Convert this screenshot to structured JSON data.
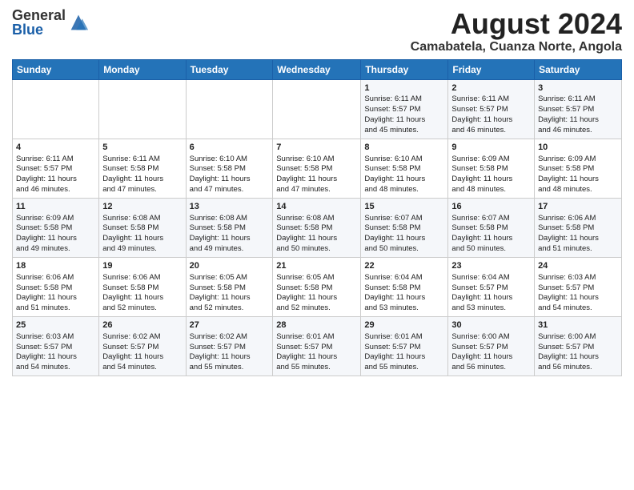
{
  "header": {
    "logo_general": "General",
    "logo_blue": "Blue",
    "month_title": "August 2024",
    "location": "Camabatela, Cuanza Norte, Angola"
  },
  "days_of_week": [
    "Sunday",
    "Monday",
    "Tuesday",
    "Wednesday",
    "Thursday",
    "Friday",
    "Saturday"
  ],
  "weeks": [
    [
      {
        "day": "",
        "info": ""
      },
      {
        "day": "",
        "info": ""
      },
      {
        "day": "",
        "info": ""
      },
      {
        "day": "",
        "info": ""
      },
      {
        "day": "1",
        "info": "Sunrise: 6:11 AM\nSunset: 5:57 PM\nDaylight: 11 hours\nand 45 minutes."
      },
      {
        "day": "2",
        "info": "Sunrise: 6:11 AM\nSunset: 5:57 PM\nDaylight: 11 hours\nand 46 minutes."
      },
      {
        "day": "3",
        "info": "Sunrise: 6:11 AM\nSunset: 5:57 PM\nDaylight: 11 hours\nand 46 minutes."
      }
    ],
    [
      {
        "day": "4",
        "info": "Sunrise: 6:11 AM\nSunset: 5:57 PM\nDaylight: 11 hours\nand 46 minutes."
      },
      {
        "day": "5",
        "info": "Sunrise: 6:11 AM\nSunset: 5:58 PM\nDaylight: 11 hours\nand 47 minutes."
      },
      {
        "day": "6",
        "info": "Sunrise: 6:10 AM\nSunset: 5:58 PM\nDaylight: 11 hours\nand 47 minutes."
      },
      {
        "day": "7",
        "info": "Sunrise: 6:10 AM\nSunset: 5:58 PM\nDaylight: 11 hours\nand 47 minutes."
      },
      {
        "day": "8",
        "info": "Sunrise: 6:10 AM\nSunset: 5:58 PM\nDaylight: 11 hours\nand 48 minutes."
      },
      {
        "day": "9",
        "info": "Sunrise: 6:09 AM\nSunset: 5:58 PM\nDaylight: 11 hours\nand 48 minutes."
      },
      {
        "day": "10",
        "info": "Sunrise: 6:09 AM\nSunset: 5:58 PM\nDaylight: 11 hours\nand 48 minutes."
      }
    ],
    [
      {
        "day": "11",
        "info": "Sunrise: 6:09 AM\nSunset: 5:58 PM\nDaylight: 11 hours\nand 49 minutes."
      },
      {
        "day": "12",
        "info": "Sunrise: 6:08 AM\nSunset: 5:58 PM\nDaylight: 11 hours\nand 49 minutes."
      },
      {
        "day": "13",
        "info": "Sunrise: 6:08 AM\nSunset: 5:58 PM\nDaylight: 11 hours\nand 49 minutes."
      },
      {
        "day": "14",
        "info": "Sunrise: 6:08 AM\nSunset: 5:58 PM\nDaylight: 11 hours\nand 50 minutes."
      },
      {
        "day": "15",
        "info": "Sunrise: 6:07 AM\nSunset: 5:58 PM\nDaylight: 11 hours\nand 50 minutes."
      },
      {
        "day": "16",
        "info": "Sunrise: 6:07 AM\nSunset: 5:58 PM\nDaylight: 11 hours\nand 50 minutes."
      },
      {
        "day": "17",
        "info": "Sunrise: 6:06 AM\nSunset: 5:58 PM\nDaylight: 11 hours\nand 51 minutes."
      }
    ],
    [
      {
        "day": "18",
        "info": "Sunrise: 6:06 AM\nSunset: 5:58 PM\nDaylight: 11 hours\nand 51 minutes."
      },
      {
        "day": "19",
        "info": "Sunrise: 6:06 AM\nSunset: 5:58 PM\nDaylight: 11 hours\nand 52 minutes."
      },
      {
        "day": "20",
        "info": "Sunrise: 6:05 AM\nSunset: 5:58 PM\nDaylight: 11 hours\nand 52 minutes."
      },
      {
        "day": "21",
        "info": "Sunrise: 6:05 AM\nSunset: 5:58 PM\nDaylight: 11 hours\nand 52 minutes."
      },
      {
        "day": "22",
        "info": "Sunrise: 6:04 AM\nSunset: 5:58 PM\nDaylight: 11 hours\nand 53 minutes."
      },
      {
        "day": "23",
        "info": "Sunrise: 6:04 AM\nSunset: 5:57 PM\nDaylight: 11 hours\nand 53 minutes."
      },
      {
        "day": "24",
        "info": "Sunrise: 6:03 AM\nSunset: 5:57 PM\nDaylight: 11 hours\nand 54 minutes."
      }
    ],
    [
      {
        "day": "25",
        "info": "Sunrise: 6:03 AM\nSunset: 5:57 PM\nDaylight: 11 hours\nand 54 minutes."
      },
      {
        "day": "26",
        "info": "Sunrise: 6:02 AM\nSunset: 5:57 PM\nDaylight: 11 hours\nand 54 minutes."
      },
      {
        "day": "27",
        "info": "Sunrise: 6:02 AM\nSunset: 5:57 PM\nDaylight: 11 hours\nand 55 minutes."
      },
      {
        "day": "28",
        "info": "Sunrise: 6:01 AM\nSunset: 5:57 PM\nDaylight: 11 hours\nand 55 minutes."
      },
      {
        "day": "29",
        "info": "Sunrise: 6:01 AM\nSunset: 5:57 PM\nDaylight: 11 hours\nand 55 minutes."
      },
      {
        "day": "30",
        "info": "Sunrise: 6:00 AM\nSunset: 5:57 PM\nDaylight: 11 hours\nand 56 minutes."
      },
      {
        "day": "31",
        "info": "Sunrise: 6:00 AM\nSunset: 5:57 PM\nDaylight: 11 hours\nand 56 minutes."
      }
    ]
  ]
}
